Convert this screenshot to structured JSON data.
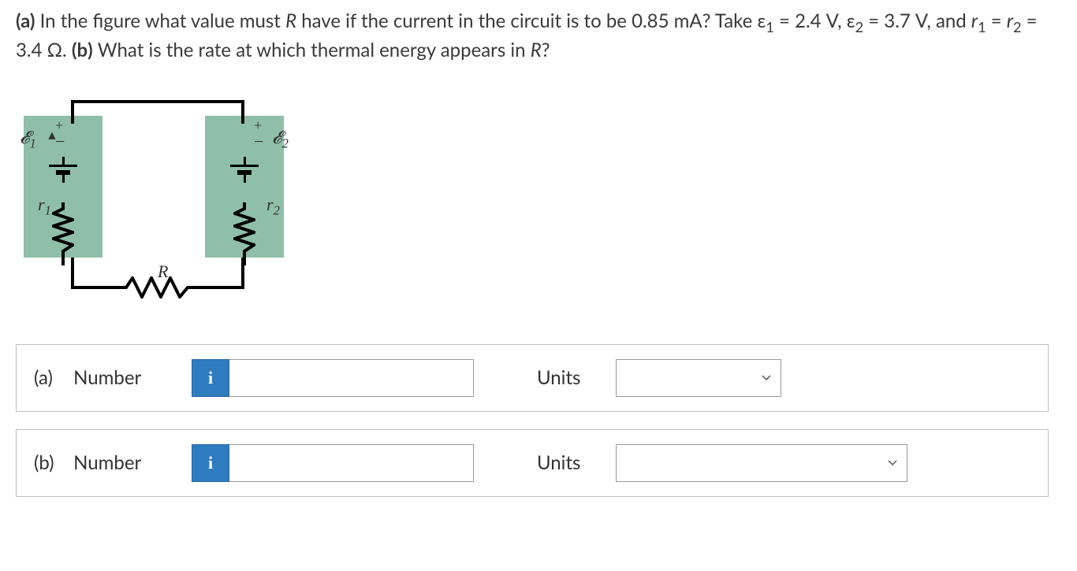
{
  "question": {
    "part_a_prefix": "(a)",
    "text_1": " In the figure what value must ",
    "R": "R",
    "text_2": " have if the current in the circuit is to be 0.85 mA? Take ε",
    "sub1": "1",
    "text_3": " = 2.4 V, ε",
    "sub2": "2",
    "text_4": " = 3.7 V, and ",
    "r1": "r",
    "r1sub": "1",
    "text_5": " = ",
    "r2": "r",
    "r2sub": "2",
    "text_6": " = 3.4 Ω. ",
    "part_b_prefix": "(b)",
    "text_7": " What is the rate at which thermal energy appears in ",
    "R2": "R",
    "text_8": "?"
  },
  "figure": {
    "emf1": "𝓔",
    "emf1_sub": "1",
    "emf2": "𝓔",
    "emf2_sub": "2",
    "r1": "r",
    "r1_sub": "1",
    "r2": "r",
    "r2_sub": "2",
    "R": "R",
    "plus": "+",
    "minus": "−"
  },
  "answers": {
    "a": {
      "part": "(a)",
      "label": "Number",
      "units_label": "Units",
      "value": "",
      "units": ""
    },
    "b": {
      "part": "(b)",
      "label": "Number",
      "units_label": "Units",
      "value": "",
      "units": ""
    }
  },
  "icons": {
    "info": "i"
  }
}
